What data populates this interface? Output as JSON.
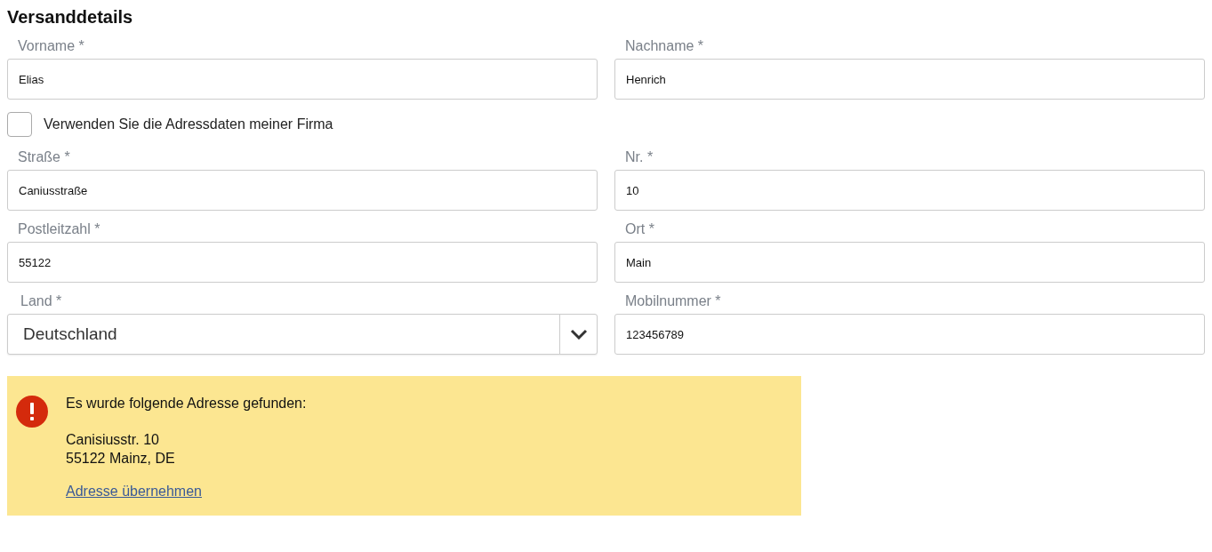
{
  "title": "Versanddetails",
  "name_fields": [
    {
      "kind": "text",
      "label": "Vorname *",
      "value": "Elias"
    },
    {
      "kind": "text",
      "label": "Nachname *",
      "value": "Henrich"
    }
  ],
  "company_checkbox": {
    "label": "Verwenden Sie die Adressdaten meiner Firma",
    "checked": false
  },
  "address_fields": [
    {
      "kind": "text",
      "label": "Straße *",
      "value": "Caniusstraße"
    },
    {
      "kind": "text",
      "label": "Nr. *",
      "value": "10"
    },
    {
      "kind": "text",
      "label": "Postleitzahl *",
      "value": "55122"
    },
    {
      "kind": "text",
      "label": "Ort *",
      "value": "Main"
    },
    {
      "kind": "select",
      "label": "Land *",
      "value": "Deutschland"
    },
    {
      "kind": "text",
      "label": "Mobilnummer *",
      "value": "123456789"
    }
  ],
  "alert": {
    "message": "Es wurde folgende Adresse gefunden:",
    "address_lines": [
      "Canisiusstr. 10",
      "55122 Mainz, DE"
    ],
    "link": "Adresse übernehmen"
  }
}
